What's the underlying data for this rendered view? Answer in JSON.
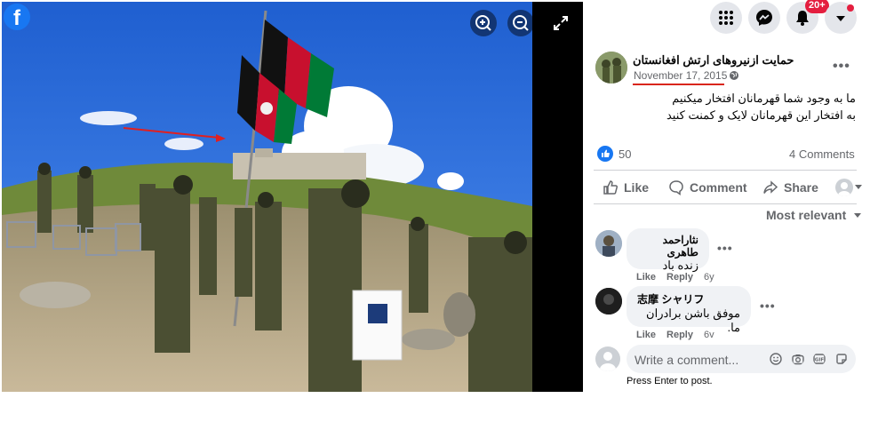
{
  "viewer": {
    "logo": "f",
    "zoom_in_icon": "magnify-plus-icon",
    "zoom_out_icon": "magnify-minus-icon",
    "fullscreen_icon": "expand-icon"
  },
  "topbar": {
    "notification_badge": "20+",
    "icons": [
      "menu-grid-icon",
      "messenger-icon",
      "bell-icon",
      "account-caret-icon"
    ]
  },
  "post": {
    "page_name": "حمایت ازنیروهای ارتش افغانستان",
    "date": "November 17, 2015",
    "privacy_icon": "globe-icon",
    "text_line1": "ما به وجود شما قهرمانان افتخار میکنیم",
    "text_line2": "به افتخار این قهرمانان لایک و کمنت کنید",
    "reactions_count": "50",
    "comments_count": "4 Comments"
  },
  "actions": {
    "like": "Like",
    "comment": "Comment",
    "share": "Share"
  },
  "sort_label": "Most relevant",
  "comments": [
    {
      "author": "نثاراحمد طاهری",
      "text": "زنده باد",
      "like": "Like",
      "reply": "Reply",
      "age": "6y"
    },
    {
      "author": "志摩 シャリフ",
      "text": "موفق باشن برادران ما.",
      "like": "Like",
      "reply": "Reply",
      "age": "6v"
    }
  ],
  "composer": {
    "placeholder": "Write a comment...",
    "hint": "Press Enter to post.",
    "icons": [
      "emoji-icon",
      "camera-icon",
      "gif-icon",
      "sticker-icon"
    ]
  },
  "colors": {
    "accent": "#1877f2",
    "badge": "#e41e3f",
    "underline": "#d9261c"
  }
}
